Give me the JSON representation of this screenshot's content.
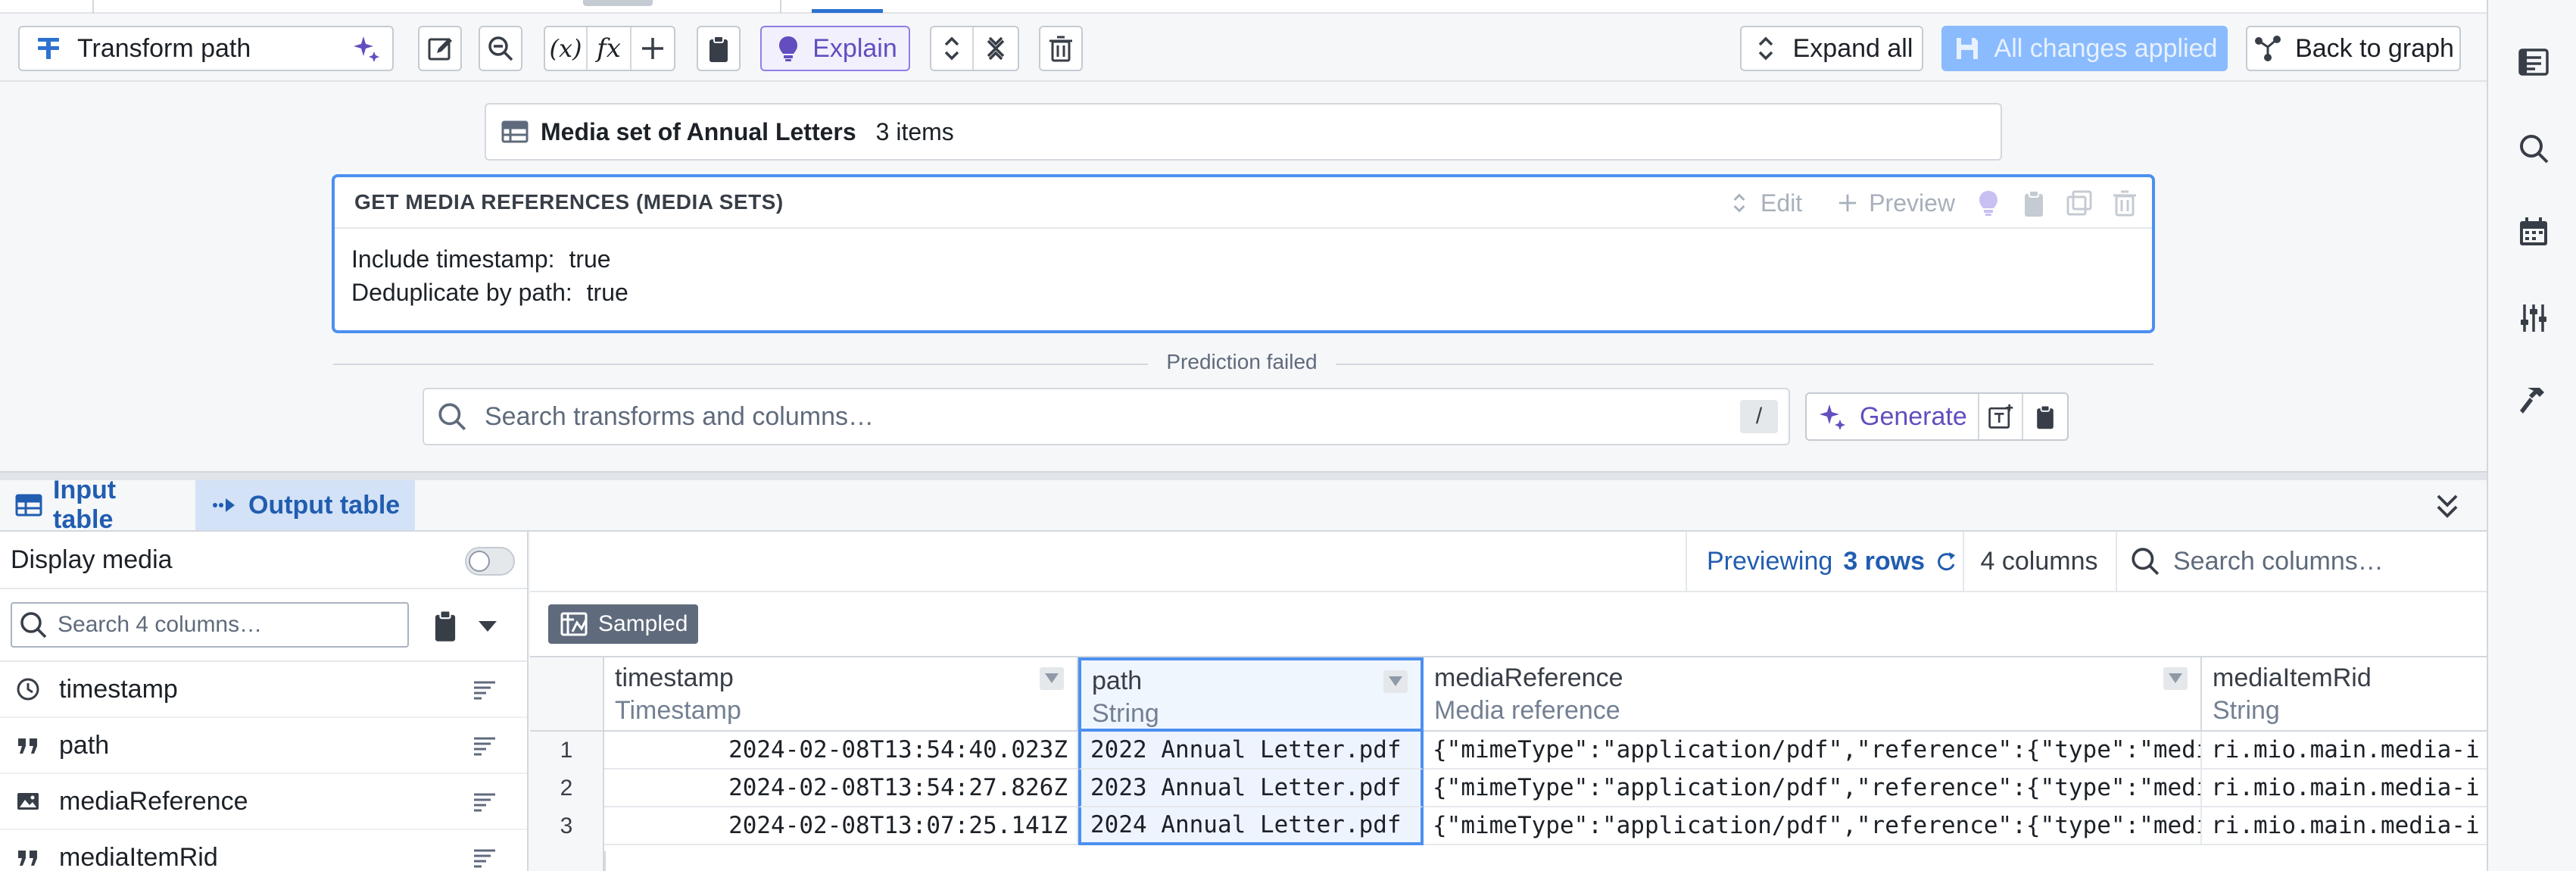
{
  "toolbar": {
    "board_title": "Transform path",
    "explain_label": "Explain",
    "expand_all_label": "Expand all",
    "all_changes_label": "All changes applied",
    "back_label": "Back to graph",
    "variable_symbol": "(x)",
    "function_symbol": "fx"
  },
  "source": {
    "title": "Media set of Annual Letters",
    "count": "3 items"
  },
  "transform": {
    "title": "GET MEDIA REFERENCES (MEDIA SETS)",
    "edit_label": "Edit",
    "preview_label": "Preview",
    "params": [
      {
        "label": "Include timestamp:",
        "value": "true"
      },
      {
        "label": "Deduplicate by path:",
        "value": "true"
      }
    ]
  },
  "prediction_status": "Prediction failed",
  "search": {
    "placeholder": "Search transforms and columns…",
    "shortcut": "/",
    "generate_label": "Generate"
  },
  "bottom_tabs": {
    "input_label": "Input table",
    "output_label": "Output table"
  },
  "left_panel": {
    "display_media_label": "Display media",
    "column_search_placeholder": "Search 4 columns…",
    "columns": [
      {
        "name": "timestamp",
        "icon": "clock-icon"
      },
      {
        "name": "path",
        "icon": "quote-icon"
      },
      {
        "name": "mediaReference",
        "icon": "image-icon"
      },
      {
        "name": "mediaItemRid",
        "icon": "quote-icon"
      }
    ]
  },
  "preview": {
    "previewing_label": "Previewing",
    "rows_label": "3 rows",
    "columns_label": "4 columns",
    "search_columns_placeholder": "Search columns…",
    "sampled_label": "Sampled"
  },
  "table": {
    "headers": [
      {
        "name": "timestamp",
        "type": "Timestamp"
      },
      {
        "name": "path",
        "type": "String"
      },
      {
        "name": "mediaReference",
        "type": "Media reference"
      },
      {
        "name": "mediaItemRid",
        "type": "String"
      }
    ],
    "rows": [
      {
        "num": "1",
        "timestamp": "2024-02-08T13:54:40.023Z",
        "path": "2022 Annual Letter.pdf",
        "mediaReference": "{\"mimeType\":\"application/pdf\",\"reference\":{\"type\":\"mediaS",
        "mediaItemRid": "ri.mio.main.media-i"
      },
      {
        "num": "2",
        "timestamp": "2024-02-08T13:54:27.826Z",
        "path": "2023 Annual Letter.pdf",
        "mediaReference": "{\"mimeType\":\"application/pdf\",\"reference\":{\"type\":\"mediaS",
        "mediaItemRid": "ri.mio.main.media-i"
      },
      {
        "num": "3",
        "timestamp": "2024-02-08T13:07:25.141Z",
        "path": "2024 Annual Letter.pdf",
        "mediaReference": "{\"mimeType\":\"application/pdf\",\"reference\":{\"type\":\"mediaS",
        "mediaItemRid": "ri.mio.main.media-i"
      }
    ]
  },
  "colors": {
    "accent": "#2d72d2",
    "ai_purple": "#634dbf",
    "selection_border": "#4c90f0",
    "applied_disabled": "#8abbff"
  }
}
